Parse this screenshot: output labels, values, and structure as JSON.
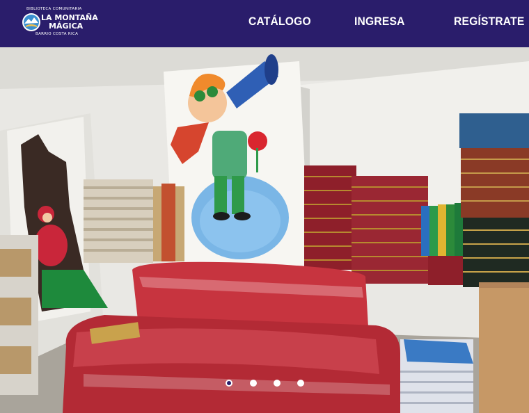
{
  "brand": {
    "line_top": "BIBLIOTECA COMUNITARIA",
    "name_line1": "LA MONTAÑA",
    "name_line2": "MÁGICA",
    "line_bottom": "BARRIO COSTA RICA"
  },
  "nav": {
    "items": [
      {
        "label": "CATÁLOGO"
      },
      {
        "label": "INGRESA"
      },
      {
        "label": "REGÍSTRATE"
      }
    ]
  },
  "colors": {
    "navbar": "#2a1d6b",
    "nav_text": "#ffffff",
    "dot_active": "#2a1d6b",
    "dot_inactive": "#ffffff"
  },
  "carousel": {
    "slide_count": 4,
    "active_index": 0
  }
}
